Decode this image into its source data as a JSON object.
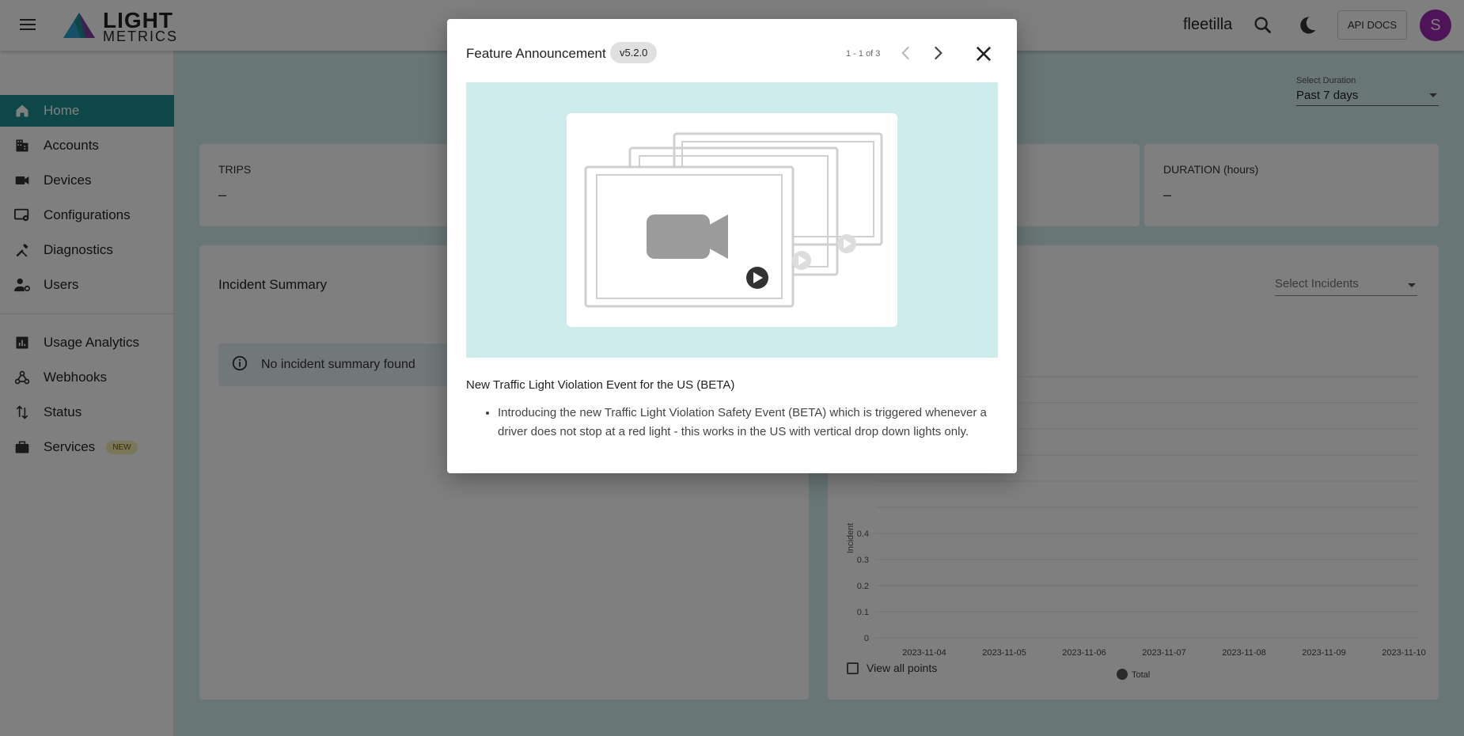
{
  "topbar": {
    "logo_line1": "LIGHT",
    "logo_line2": "METRICS",
    "user_name": "fleetilla",
    "api_docs_label": "API DOCS",
    "avatar_initial": "S"
  },
  "sidebar": {
    "items": [
      {
        "label": "Home",
        "icon": "home-icon",
        "active": true
      },
      {
        "label": "Accounts",
        "icon": "building-icon"
      },
      {
        "label": "Devices",
        "icon": "camera-icon"
      },
      {
        "label": "Configurations",
        "icon": "settings-display-icon"
      },
      {
        "label": "Diagnostics",
        "icon": "tools-icon"
      },
      {
        "label": "Users",
        "icon": "user-gear-icon"
      },
      {
        "label": "Usage Analytics",
        "icon": "analytics-icon"
      },
      {
        "label": "Webhooks",
        "icon": "webhook-icon"
      },
      {
        "label": "Status",
        "icon": "sort-arrows-icon"
      },
      {
        "label": "Services",
        "icon": "briefcase-icon",
        "badge": "NEW"
      }
    ]
  },
  "main": {
    "duration_caption": "Select Duration",
    "duration_value": "Past 7 days",
    "trips_caption": "TRIPS",
    "trips_value": "–",
    "duration_card_caption": "DURATION (hours)",
    "duration_card_value": "–",
    "incident_summary_title": "Incident Summary",
    "no_incident_message": "No incident summary found",
    "select_incidents_placeholder": "Select Incidents",
    "view_all_points_label": "View all points"
  },
  "chart_data": {
    "type": "line",
    "ylabel": "Incident",
    "y_ticks": [
      "0.4",
      "0.3",
      "0.2",
      "0.1",
      "0"
    ],
    "categories": [
      "2023-11-04",
      "2023-11-05",
      "2023-11-06",
      "2023-11-07",
      "2023-11-08",
      "2023-11-09",
      "2023-11-10"
    ],
    "series": [
      {
        "name": "Total",
        "values": []
      }
    ],
    "legend": "bottom"
  },
  "modal": {
    "title": "Feature Announcement",
    "version": "v5.2.0",
    "pager": "1 - 1 of 3",
    "heading": "New Traffic Light Violation Event for the US (BETA)",
    "bullets": [
      "Introducing the new Traffic Light Violation Safety Event (BETA) which is triggered whenever a driver does not stop at a red light - this works in the US with vertical drop down lights only."
    ]
  },
  "colors": {
    "accent": "#1a8e8e",
    "avatar": "#9c27b0",
    "image_bg": "#cfecec"
  }
}
